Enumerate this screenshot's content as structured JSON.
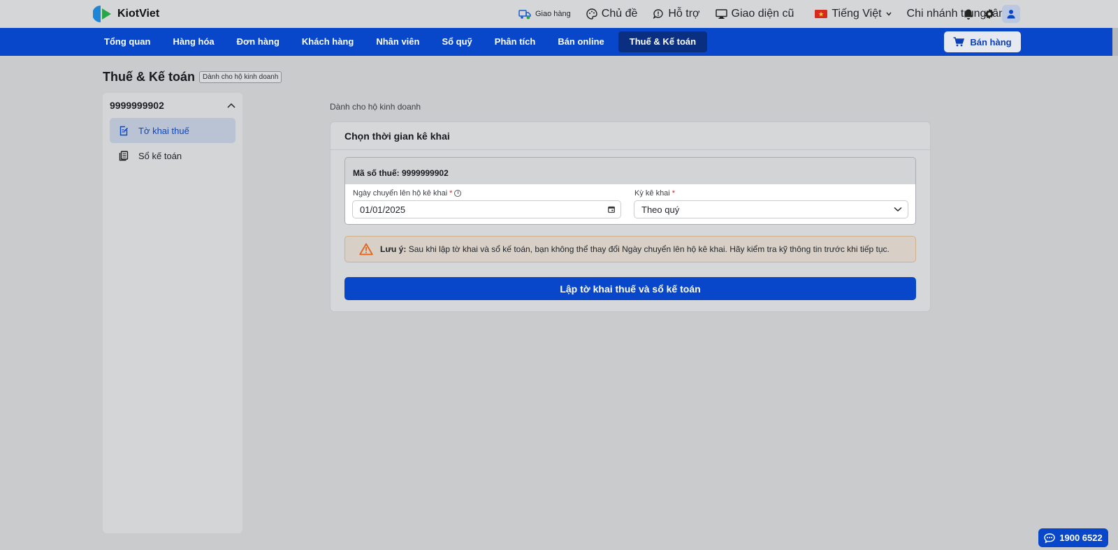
{
  "brand": {
    "name": "KiotViet"
  },
  "topbar": {
    "items": [
      {
        "label": "Giao hàng",
        "icon": "delivery-truck-icon"
      },
      {
        "label": "Chủ đề",
        "icon": "palette-icon"
      },
      {
        "label": "Hỗ trợ",
        "icon": "chat-support-icon"
      },
      {
        "label": "Giao diện cũ",
        "icon": "monitor-icon"
      }
    ],
    "language": "Tiếng Việt",
    "branch": "Chi nhánh trung tâm"
  },
  "nav": {
    "items": [
      "Tổng quan",
      "Hàng hóa",
      "Đơn hàng",
      "Khách hàng",
      "Nhân viên",
      "Sổ quỹ",
      "Phân tích",
      "Bán online",
      "Thuế & Kế toán"
    ],
    "active": "Thuế & Kế toán",
    "sell_label": "Bán hàng"
  },
  "page": {
    "title": "Thuế & Kế toán",
    "tag": "Dành cho hộ kinh doanh"
  },
  "sidebar": {
    "tax_id": "9999999902",
    "items": [
      {
        "label": "Tờ khai thuế",
        "active": true
      },
      {
        "label": "Sổ kế toán",
        "active": false
      }
    ]
  },
  "main": {
    "crumb": "Dành cho hộ kinh doanh",
    "card_title": "Chọn thời gian kê khai",
    "tax_code_line": "Mã số thuế: 9999999902",
    "date_label": "Ngày chuyển lên hộ kê khai",
    "date_value": "01/01/2025",
    "period_label": "Kỳ kê khai",
    "period_value": "Theo quý",
    "note_bold": "Lưu ý:",
    "note_text": "Sau khi lập tờ khai và sổ kế toán, bạn không thể thay đổi Ngày chuyển lên hộ kê khai. Hãy kiểm tra kỹ thông tin trước khi tiếp tục.",
    "primary_button": "Lập tờ khai thuế và sổ kế toán"
  },
  "hotline": "1900 6522",
  "colors": {
    "primary": "#0846ca",
    "nav_active": "#0a2f80",
    "warning": "#e0641c"
  }
}
